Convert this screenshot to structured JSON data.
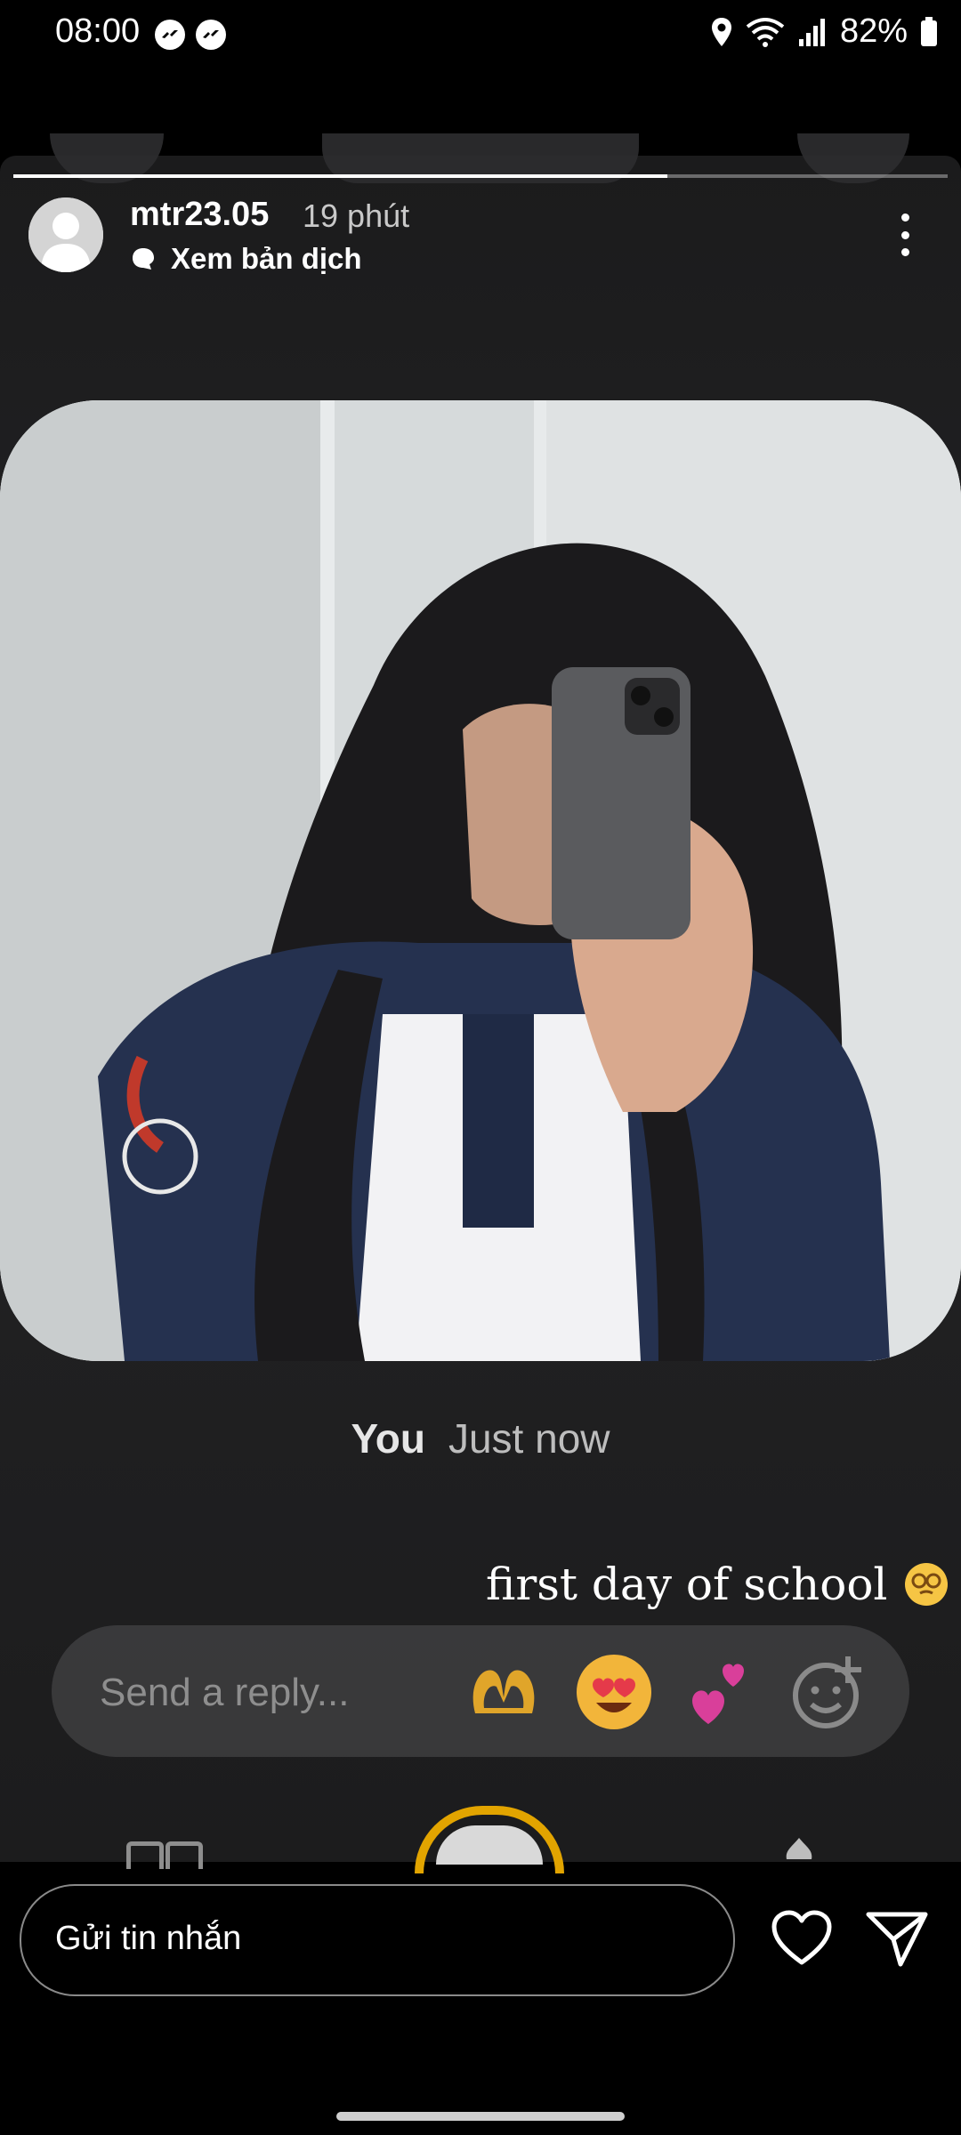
{
  "status": {
    "time": "08:00",
    "battery": "82%"
  },
  "story": {
    "username": "mtr23.05",
    "time_ago": "19 phút",
    "translate_label": "Xem bản dịch",
    "progress": 0.7,
    "inner_meta": {
      "you": "You",
      "time": "Just now"
    },
    "caption": "first day of school",
    "reply_placeholder": "Send a reply...",
    "quick_reactions": [
      "heart-hands-emoji",
      "heart-eyes-emoji",
      "two-hearts-emoji",
      "add-reaction-icon"
    ]
  },
  "bottom": {
    "message_placeholder": "Gửi tin nhắn"
  },
  "colors": {
    "background": "#000000",
    "story_bg": "#1f1f21",
    "ring": "#e2a400"
  }
}
